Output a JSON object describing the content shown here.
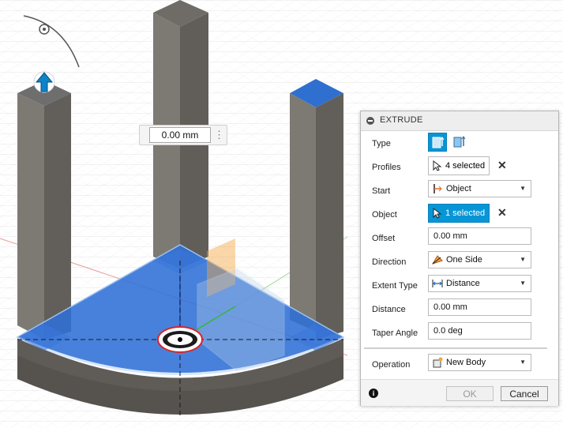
{
  "canvas": {
    "dimension_input_value": "0.00 mm",
    "dimension_menu_glyph": "⋮"
  },
  "extrude_panel": {
    "title": "EXTRUDE",
    "type": {
      "label": "Type"
    },
    "profiles": {
      "label": "Profiles",
      "value": "4 selected"
    },
    "start": {
      "label": "Start",
      "value": "Object",
      "icon": "start-object-icon"
    },
    "object": {
      "label": "Object",
      "value": "1 selected"
    },
    "offset": {
      "label": "Offset",
      "value": "0.00 mm"
    },
    "direction": {
      "label": "Direction",
      "value": "One Side",
      "icon": "one-side-icon"
    },
    "extent_type": {
      "label": "Extent Type",
      "value": "Distance",
      "icon": "distance-icon"
    },
    "distance": {
      "label": "Distance",
      "value": "0.00 mm"
    },
    "taper_angle": {
      "label": "Taper Angle",
      "value": "0.0 deg"
    },
    "operation": {
      "label": "Operation",
      "value": "New Body",
      "icon": "new-body-icon"
    },
    "ok_label": "OK",
    "cancel_label": "Cancel"
  },
  "colors": {
    "selection_blue": "#1e6fd9",
    "button_active": "#0696d7",
    "panel_bg": "#ffffff"
  }
}
